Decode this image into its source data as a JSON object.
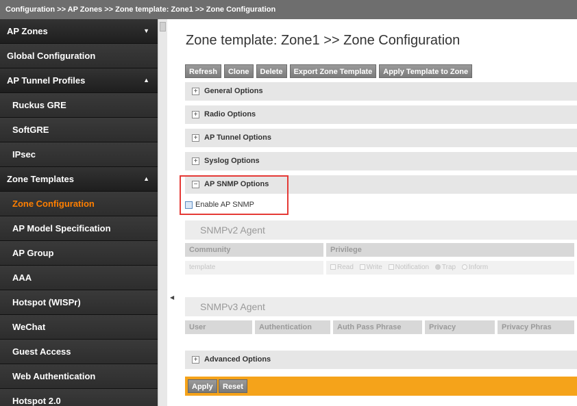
{
  "breadcrumb": "Configuration >> AP Zones >> Zone template: Zone1 >> Zone Configuration",
  "sidebar": {
    "items": [
      {
        "label": "AP Zones",
        "kind": "section",
        "arrow": "▼"
      },
      {
        "label": "Global Configuration",
        "kind": "item",
        "arrow": ""
      },
      {
        "label": "AP Tunnel Profiles",
        "kind": "section",
        "arrow": "▲"
      },
      {
        "label": "Ruckus GRE",
        "kind": "sub",
        "arrow": ""
      },
      {
        "label": "SoftGRE",
        "kind": "sub",
        "arrow": ""
      },
      {
        "label": "IPsec",
        "kind": "sub",
        "arrow": ""
      },
      {
        "label": "Zone Templates",
        "kind": "section",
        "arrow": "▲"
      },
      {
        "label": "Zone Configuration",
        "kind": "sub active",
        "arrow": ""
      },
      {
        "label": "AP Model Specification",
        "kind": "sub",
        "arrow": ""
      },
      {
        "label": "AP Group",
        "kind": "sub",
        "arrow": ""
      },
      {
        "label": "AAA",
        "kind": "sub",
        "arrow": ""
      },
      {
        "label": "Hotspot (WISPr)",
        "kind": "sub",
        "arrow": ""
      },
      {
        "label": "WeChat",
        "kind": "sub",
        "arrow": ""
      },
      {
        "label": "Guest Access",
        "kind": "sub",
        "arrow": ""
      },
      {
        "label": "Web Authentication",
        "kind": "sub",
        "arrow": ""
      },
      {
        "label": "Hotspot 2.0",
        "kind": "sub",
        "arrow": ""
      }
    ]
  },
  "page_title": "Zone template: Zone1 >> Zone Configuration",
  "toolbar": {
    "refresh": "Refresh",
    "clone": "Clone",
    "delete": "Delete",
    "export": "Export Zone Template",
    "apply_template": "Apply Template to Zone"
  },
  "sections": {
    "general": "General Options",
    "radio": "Radio Options",
    "ap_tunnel": "AP Tunnel Options",
    "syslog": "Syslog Options",
    "ap_snmp": "AP SNMP Options",
    "advanced": "Advanced Options"
  },
  "snmp": {
    "enable_label": "Enable AP SNMP",
    "v2": {
      "title": "SNMPv2 Agent",
      "col_community": "Community",
      "col_privilege": "Privilege",
      "community_value": "template",
      "opt_read": "Read",
      "opt_write": "Write",
      "opt_notification": "Notification",
      "opt_trap": "Trap",
      "opt_inform": "Inform"
    },
    "v3": {
      "title": "SNMPv3 Agent",
      "col_user": "User",
      "col_auth": "Authentication",
      "col_auth_pass": "Auth Pass Phrase",
      "col_privacy": "Privacy",
      "col_privacy_phrase": "Privacy Phras"
    }
  },
  "footer": {
    "apply": "Apply",
    "reset": "Reset"
  },
  "icons": {
    "expand": "+",
    "collapse": "−",
    "handle": "◀"
  },
  "colors": {
    "accent_active": "#ff7f00",
    "apply_bar": "#f5a31a",
    "highlight": "#e53935"
  }
}
